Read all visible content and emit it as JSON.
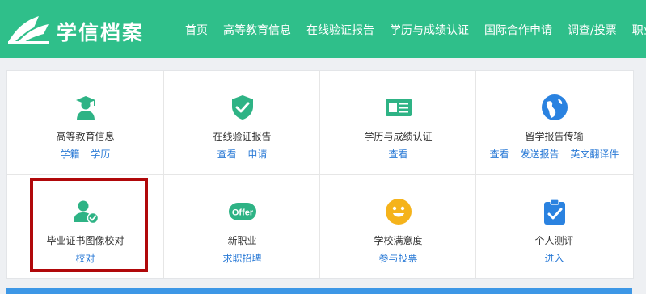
{
  "header": {
    "logo_text": "学信档案",
    "nav": [
      "首页",
      "高等教育信息",
      "在线验证报告",
      "学历与成绩认证",
      "国际合作申请",
      "调查/投票",
      "职业"
    ]
  },
  "colors": {
    "header_green": "#2fbf8a",
    "icon_green": "#2eb385",
    "link_blue": "#2a7ad6",
    "highlight_red": "#b0080a"
  },
  "grid": {
    "row1": [
      {
        "icon": "graduate-icon",
        "title": "高等教育信息",
        "links": [
          "学籍",
          "学历"
        ]
      },
      {
        "icon": "shield-check-icon",
        "title": "在线验证报告",
        "links": [
          "查看",
          "申请"
        ]
      },
      {
        "icon": "id-card-icon",
        "title": "学历与成绩认证",
        "links": [
          "查看"
        ]
      },
      {
        "icon": "globe-icon",
        "title": "留学报告传输",
        "links": [
          "查看",
          "发送报告",
          "英文翻译件"
        ]
      }
    ],
    "row2": [
      {
        "icon": "user-check-icon",
        "title": "毕业证书图像校对",
        "links": [
          "校对"
        ]
      },
      {
        "icon": "offer-icon",
        "badge": "Offer",
        "title": "新职业",
        "links": [
          "求职招聘"
        ]
      },
      {
        "icon": "smiley-icon",
        "title": "学校满意度",
        "links": [
          "参与投票"
        ]
      },
      {
        "icon": "clipboard-check-icon",
        "title": "个人测评",
        "links": [
          "进入"
        ]
      }
    ]
  }
}
